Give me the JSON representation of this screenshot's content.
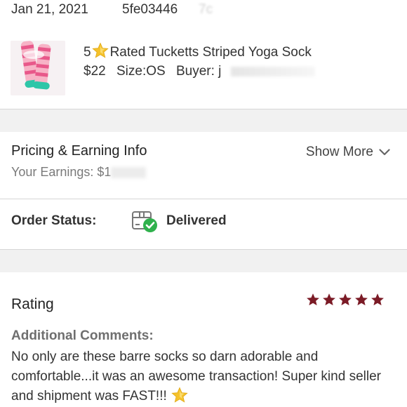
{
  "header": {
    "date": "Jan 21, 2021",
    "order_id": "5fe03446",
    "order_id_faded": "7c"
  },
  "item": {
    "rating_prefix": "5",
    "title": "Rated Tucketts Striped Yoga Sock",
    "price": "$22",
    "size": "Size:OS",
    "buyer_label": "Buyer: j"
  },
  "pricing": {
    "title": "Pricing & Earning Info",
    "earnings_label": "Your Earnings: $1",
    "show_more": "Show More"
  },
  "order_status": {
    "label": "Order Status:",
    "value": "Delivered"
  },
  "rating": {
    "title": "Rating",
    "stars": 5,
    "star_color": "#7b1b26",
    "comments_label": "Additional Comments:",
    "comments_text": "No only are these barre socks so darn adorable and comfortable...it was an awesome transaction! Super kind seller and shipment was FAST!!!"
  },
  "colors": {
    "accent_star": "#f5c22b",
    "delivered_check": "#2fb14c",
    "divider": "#d6d6d6",
    "section_gap": "#f1f1f1"
  }
}
